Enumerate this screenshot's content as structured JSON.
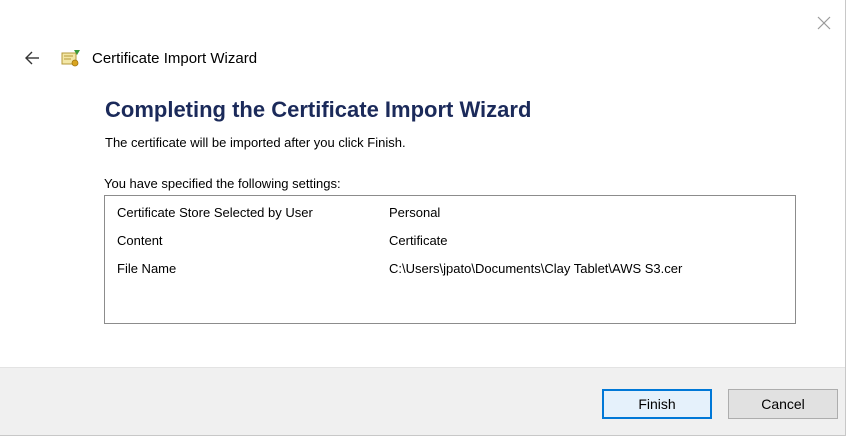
{
  "window": {
    "title": "Certificate Import Wizard"
  },
  "icons": {
    "close": "close-icon",
    "back": "back-arrow-icon",
    "certificate": "certificate-icon"
  },
  "main": {
    "heading": "Completing the Certificate Import Wizard",
    "description": "The certificate will be imported after you click Finish.",
    "settings_label": "You have specified the following settings:",
    "settings": [
      {
        "key": "Certificate Store Selected by User",
        "value": "Personal"
      },
      {
        "key": "Content",
        "value": "Certificate"
      },
      {
        "key": "File Name",
        "value": "C:\\Users\\jpato\\Documents\\Clay Tablet\\AWS S3.cer"
      }
    ]
  },
  "footer": {
    "finish_label": "Finish",
    "cancel_label": "Cancel"
  },
  "colors": {
    "heading": "#1b2a5a",
    "primary_button_border": "#0078d7",
    "footer_bg": "#f0f0f0"
  }
}
